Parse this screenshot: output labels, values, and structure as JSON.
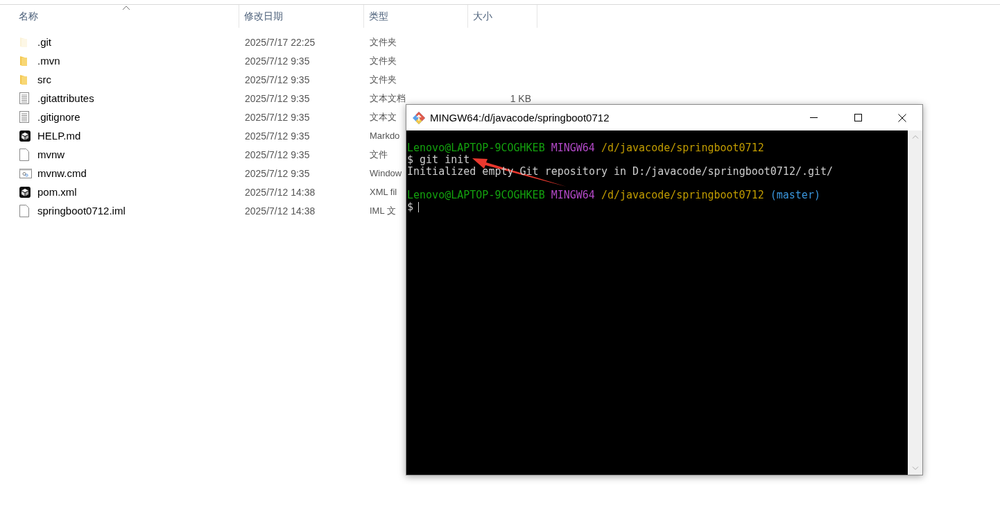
{
  "file_list": {
    "columns": [
      {
        "label": "名称",
        "sorted": true
      },
      {
        "label": "修改日期",
        "sorted": false
      },
      {
        "label": "类型",
        "sorted": false
      },
      {
        "label": "大小",
        "sorted": false
      }
    ],
    "rows": [
      {
        "kind": "folder",
        "faded": true,
        "name": ".git",
        "modified": "2025/7/17 22:25",
        "type": "文件夹"
      },
      {
        "kind": "folder",
        "faded": false,
        "name": ".mvn",
        "modified": "2025/7/12 9:35",
        "type": "文件夹"
      },
      {
        "kind": "folder",
        "faded": false,
        "name": "src",
        "modified": "2025/7/12 9:35",
        "type": "文件夹"
      },
      {
        "kind": "text",
        "faded": false,
        "name": ".gitattributes",
        "modified": "2025/7/12 9:35",
        "type": "文本文档",
        "size": "1 KB"
      },
      {
        "kind": "text",
        "faded": false,
        "name": ".gitignore",
        "modified": "2025/7/12 9:35",
        "type": "文本文"
      },
      {
        "kind": "app",
        "faded": false,
        "name": "HELP.md",
        "modified": "2025/7/12 9:35",
        "type": "Markdo"
      },
      {
        "kind": "file",
        "faded": false,
        "name": "mvnw",
        "modified": "2025/7/12 9:35",
        "type": "文件"
      },
      {
        "kind": "cmd",
        "faded": false,
        "name": "mvnw.cmd",
        "modified": "2025/7/12 9:35",
        "type": "Window"
      },
      {
        "kind": "app",
        "faded": false,
        "name": "pom.xml",
        "modified": "2025/7/12 14:38",
        "type": "XML fil"
      },
      {
        "kind": "file",
        "faded": false,
        "name": "springboot0712.iml",
        "modified": "2025/7/12 14:38",
        "type": "IML 文"
      }
    ]
  },
  "terminal": {
    "title": "MINGW64:/d/javacode/springboot0712",
    "lines": [
      {
        "kind": "text",
        "segments": [
          {
            "text": "Lenovo@LAPTOP-9COGHKEB",
            "color": "#13a10e"
          },
          {
            "text": "MINGW64",
            "color": "#b148c6"
          },
          {
            "text": "/d/javacode/springboot0712",
            "color": "#c19c00"
          }
        ]
      },
      {
        "kind": "text",
        "segments": [
          {
            "text": "$ git init",
            "color": "#cccccc"
          }
        ]
      },
      {
        "kind": "text",
        "segments": [
          {
            "text": "Initialized empty Git repository in D:/javacode/springboot0712/.git/",
            "color": "#cccccc"
          }
        ]
      },
      {
        "kind": "blank"
      },
      {
        "kind": "text",
        "segments": [
          {
            "text": "Lenovo@LAPTOP-9COGHKEB",
            "color": "#13a10e"
          },
          {
            "text": "MINGW64",
            "color": "#b148c6"
          },
          {
            "text": "/d/javacode/springboot0712",
            "color": "#c19c00"
          },
          {
            "text": "(master)",
            "color": "#3a96dd"
          }
        ]
      },
      {
        "kind": "prompt",
        "segments": [
          {
            "text": "$",
            "color": "#cccccc"
          }
        ]
      }
    ]
  }
}
